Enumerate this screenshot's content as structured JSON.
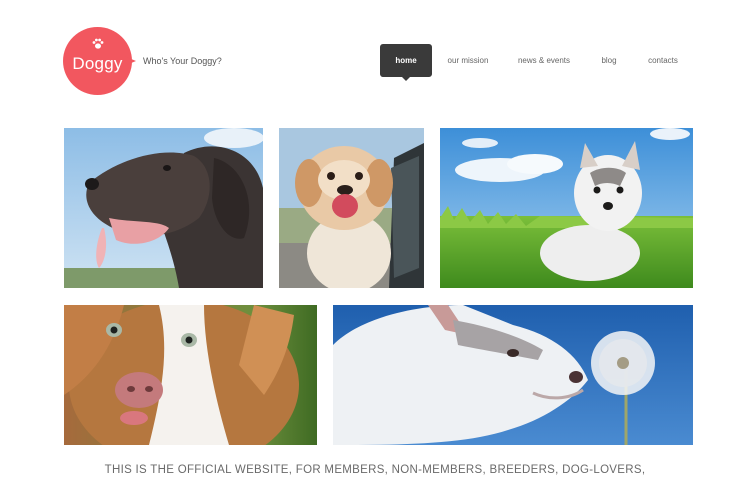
{
  "header": {
    "logo_text": "Doggy",
    "tagline": "Who's Your Doggy?",
    "brand_color": "#f2575f"
  },
  "nav": {
    "items": [
      {
        "label": "home",
        "active": true
      },
      {
        "label": "our mission",
        "active": false
      },
      {
        "label": "news & events",
        "active": false
      },
      {
        "label": "blog",
        "active": false
      },
      {
        "label": "contacts",
        "active": false
      }
    ]
  },
  "gallery": {
    "photos": [
      {
        "name": "photo-pointer-dog"
      },
      {
        "name": "photo-shih-tzu"
      },
      {
        "name": "photo-husky-puppy-grass"
      },
      {
        "name": "photo-aussie-puppy"
      },
      {
        "name": "photo-husky-dandelion"
      }
    ]
  },
  "footer": {
    "text": "THIS IS THE OFFICIAL  WEBSITE, FOR MEMBERS, NON-MEMBERS, BREEDERS, DOG-LOVERS,"
  }
}
